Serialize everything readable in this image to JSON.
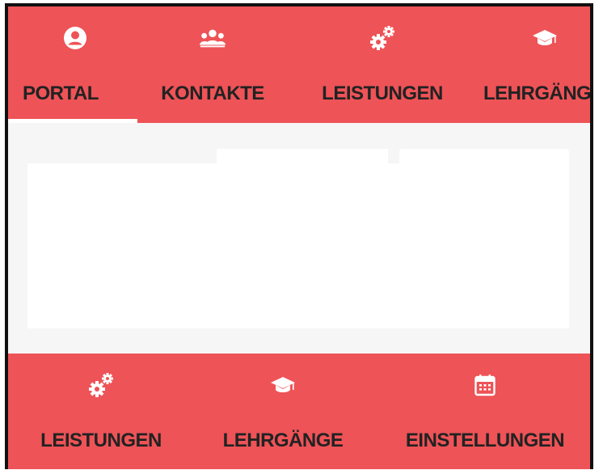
{
  "top_nav": {
    "tabs": [
      {
        "label": "PORTAL",
        "icon": "account-circle-icon",
        "active": true
      },
      {
        "label": "KONTAKTE",
        "icon": "contacts-group-icon",
        "active": false
      },
      {
        "label": "LEISTUNGEN",
        "icon": "gears-icon",
        "active": false
      },
      {
        "label": "LEHRGÄNGE",
        "icon": "graduation-cap-icon",
        "active": false
      }
    ]
  },
  "bottom_nav": {
    "tabs": [
      {
        "label": "LEISTUNGEN",
        "icon": "gears-icon"
      },
      {
        "label": "LEHRGÄNGE",
        "icon": "graduation-cap-icon"
      },
      {
        "label": "EINSTELLUNGEN",
        "icon": "calendar-icon"
      }
    ]
  },
  "colors": {
    "bar_background": "#ee5357",
    "text": "#222222",
    "indicator": "#ffffff",
    "content_background": "#f6f6f6"
  }
}
